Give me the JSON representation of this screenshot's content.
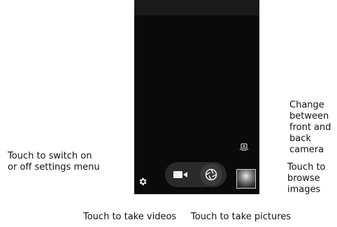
{
  "annotations": {
    "settings_menu": "Touch to switch on\nor off settings menu",
    "change_camera": "Change\nbetween\nfront and\nback\ncamera",
    "browse_images": "Touch to\nbrowse\nimages",
    "take_videos": "Touch to take videos",
    "take_pictures": "Touch to take pictures"
  },
  "icons": {
    "settings": "gear-icon",
    "video": "video-camera-icon",
    "shutter": "shutter-aperture-icon",
    "switch_camera": "camera-switch-icon",
    "gallery": "gallery-thumbnail"
  },
  "colors": {
    "viewfinder": "#0a0a0a",
    "controls_bg": "#2a2a2a"
  }
}
